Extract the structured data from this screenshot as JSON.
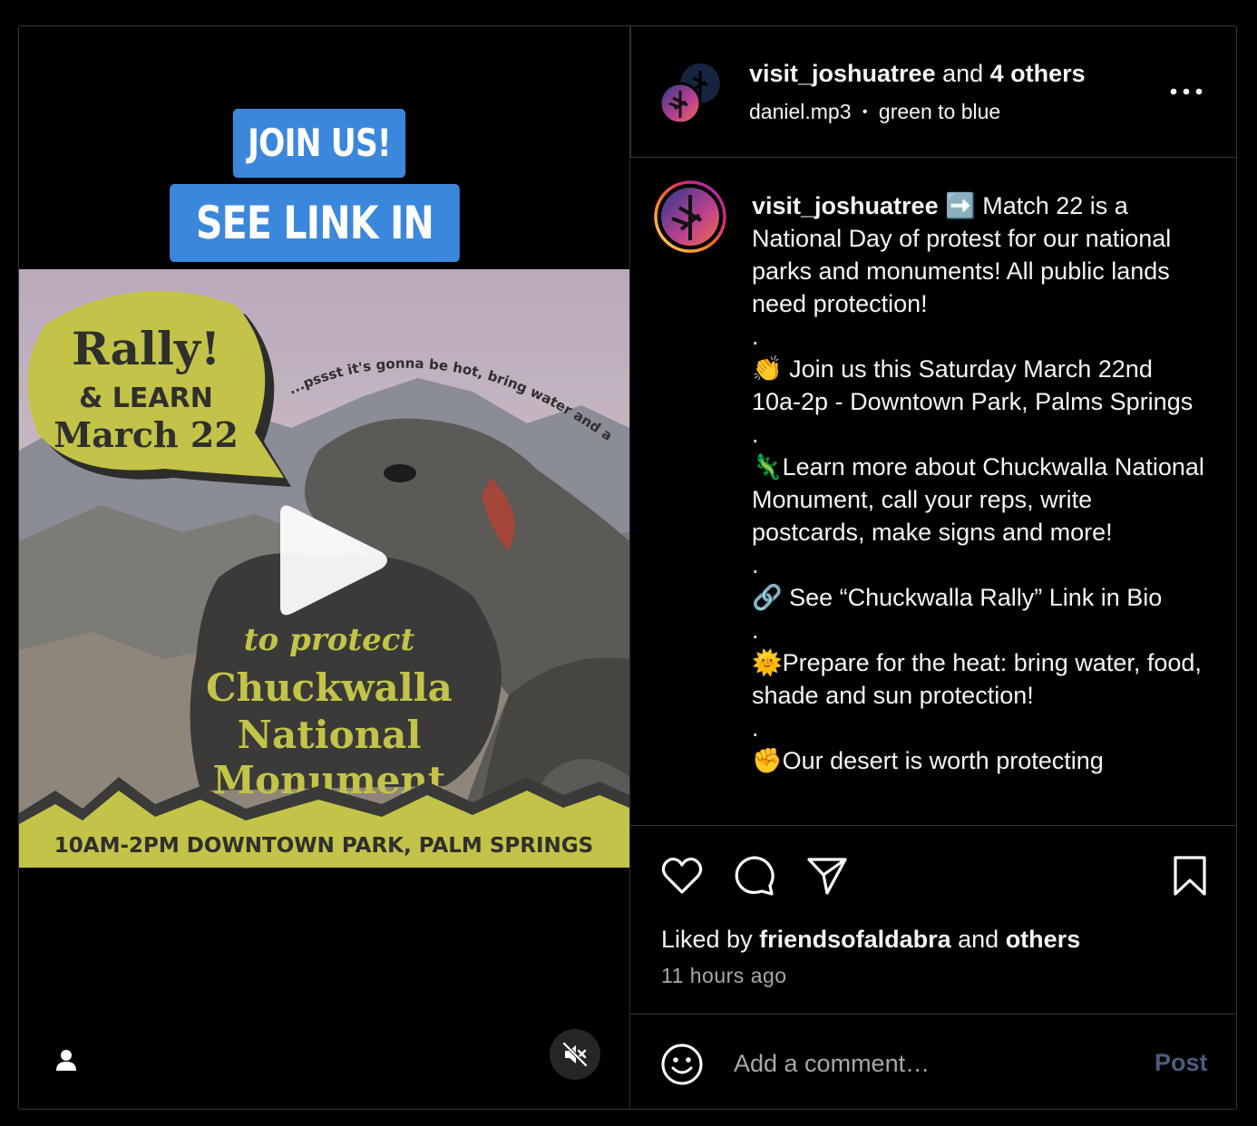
{
  "media": {
    "overlay_line1": "JOIN US!",
    "overlay_line2": "SEE LINK IN BIO",
    "poster": {
      "headline": "Rally!",
      "sub1": "& LEARN",
      "sub2": "March 22",
      "curve_text": "...pssst it's gonna be hot, bring water and a hat",
      "protect_1": "to protect",
      "protect_2": "Chuckwalla",
      "protect_3": "National",
      "protect_4": "Monument",
      "footer": "10AM-2PM DOWNTOWN PARK, PALM SPRINGS"
    }
  },
  "header": {
    "user": "visit_joshuatree",
    "and_text": " and ",
    "others": "4 others",
    "audio": "daniel.mp3",
    "dot": "•",
    "audio2": "green to blue"
  },
  "caption": {
    "user": "visit_joshuatree",
    "lines": {
      "p1": " ➡️ Match 22 is a National Day of protest for our national parks and monuments! All public lands need protection!",
      "d1": ".",
      "p2": "👏 Join us this Saturday March 22nd 10a-2p - Downtown Park, Palms Springs",
      "d2": ".",
      "p3": "🦎Learn more about Chuckwalla National Monument, call your reps, write postcards, make signs and more!",
      "d3": ".",
      "p4": "🔗 See “Chuckwalla Rally” Link in Bio",
      "d4": ".",
      "p5": "🌞Prepare for the heat: bring water, food, shade and sun protection!",
      "d5": ".",
      "p6": "✊Our desert is worth protecting"
    }
  },
  "likes": {
    "prefix": "Liked by ",
    "user": "friendsofaldabra",
    "mid": " and ",
    "others": "others"
  },
  "time": "11 hours ago",
  "comment": {
    "placeholder": "Add a comment…",
    "post_label": "Post"
  },
  "colors": {
    "accent_blue": "#3b87dc",
    "poster_yellow": "#c2c348",
    "poster_dark": "#3a3a38",
    "post_disabled": "#4a5d7c"
  }
}
